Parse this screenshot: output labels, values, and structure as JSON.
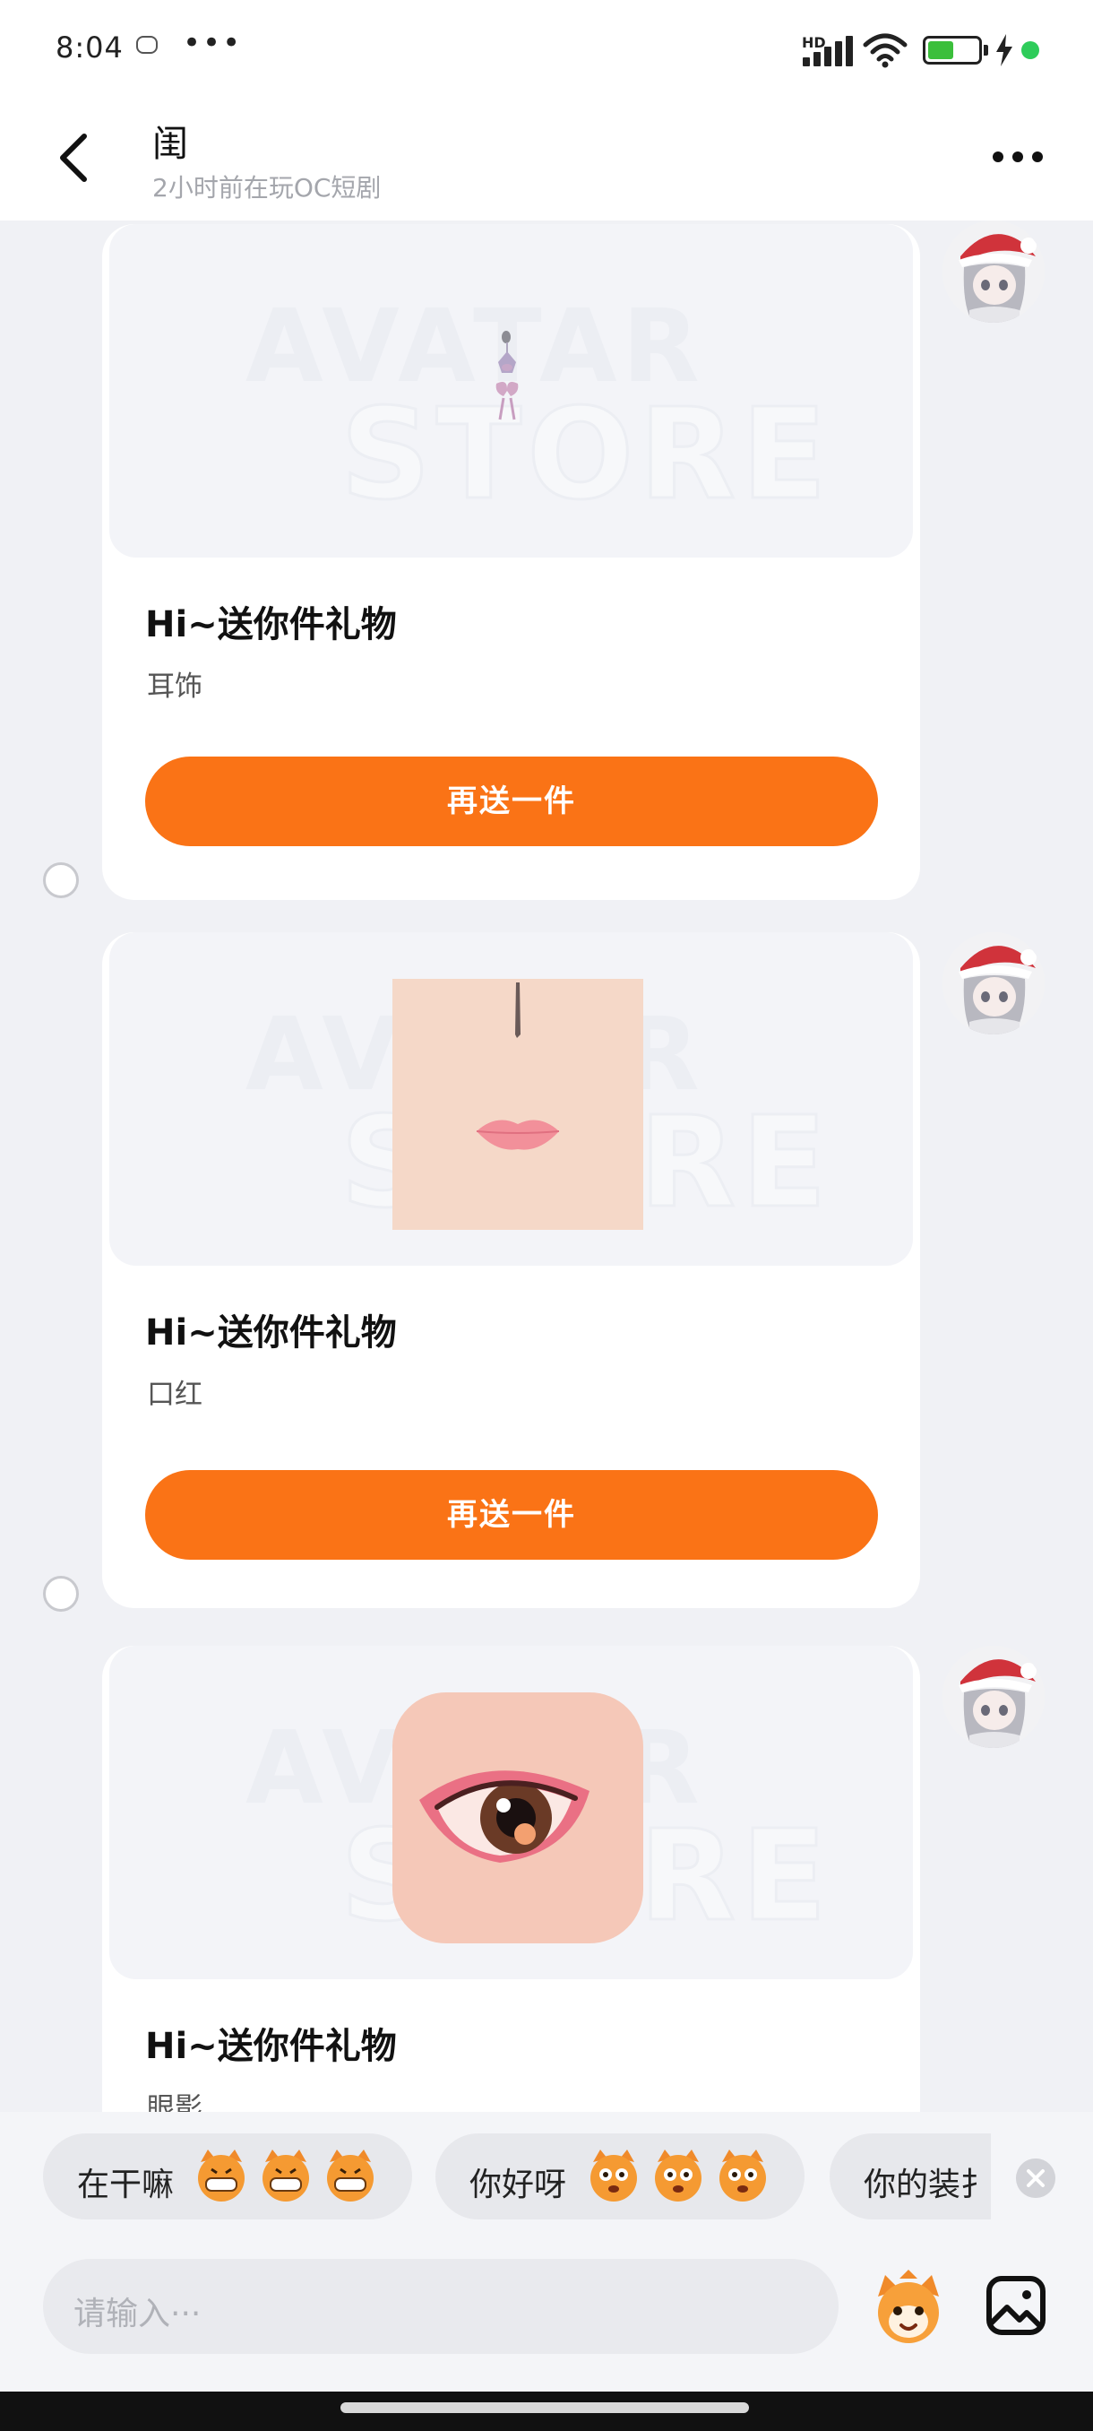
{
  "status_bar": {
    "time": "8:04",
    "dots": "•••",
    "hd": "HD"
  },
  "header": {
    "title": "闺",
    "subtitle": "2小时前在玩OC短剧"
  },
  "cards": [
    {
      "title": "Hi~送你件礼物",
      "item": "耳饰",
      "button": "再送一件"
    },
    {
      "title": "Hi~送你件礼物",
      "item": "口红",
      "button": "再送一件"
    },
    {
      "title": "Hi~送你件礼物",
      "item": "眼影"
    }
  ],
  "watermark": {
    "line1": "AVATAR",
    "line2": "STORE"
  },
  "quick_replies": [
    {
      "text": "在干嘛"
    },
    {
      "text": "你好呀"
    },
    {
      "text": "你的装扌"
    }
  ],
  "input": {
    "placeholder": "请输入···"
  },
  "colors": {
    "accent": "#fa7316",
    "background": "#f0f1f5",
    "card": "#ffffff"
  }
}
